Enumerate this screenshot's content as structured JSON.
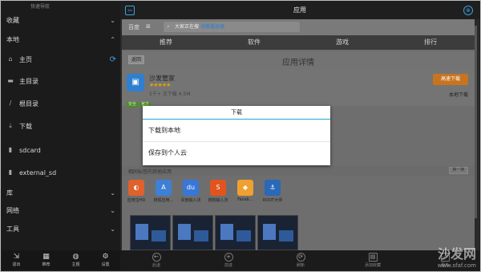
{
  "sidebar": {
    "top_hint": "快速导航",
    "items": [
      {
        "label": "收藏",
        "type": "section",
        "chev": "⌄"
      },
      {
        "label": "本地",
        "type": "section",
        "chev": "⌃"
      },
      {
        "label": "主页",
        "icon": "⌂",
        "refresh": "⟳"
      },
      {
        "label": "主目录",
        "icon": "▬"
      },
      {
        "label": "根目录",
        "icon": "/"
      },
      {
        "label": "下载",
        "icon": "⤓"
      },
      {
        "label": "sdcard",
        "icon": "▮"
      },
      {
        "label": "external_sd",
        "icon": "▮"
      },
      {
        "label": "库",
        "type": "section",
        "chev": "⌄"
      },
      {
        "label": "网络",
        "type": "section",
        "chev": "⌄"
      },
      {
        "label": "工具",
        "type": "section",
        "chev": "⌄"
      }
    ],
    "toolbar": [
      {
        "label": "退出",
        "icon": "⇲"
      },
      {
        "label": "推荐",
        "icon": "▦"
      },
      {
        "label": "主题",
        "icon": "◍"
      },
      {
        "label": "设置",
        "icon": "⚙"
      }
    ]
  },
  "main": {
    "title": "应用",
    "back_icon": "⇦",
    "close_icon": "⊗",
    "store": {
      "brand": "百度",
      "win_icon": "⊞",
      "search_prefix": "大家正在搜",
      "search_highlight": "海螺播放器",
      "tabs": [
        "推荐",
        "软件",
        "游戏",
        "排行"
      ],
      "return_label": "返回",
      "detail_title": "应用详情",
      "app_name": "沙发管家",
      "app_icon": "▣",
      "stars": "★★★★★",
      "meta": "5千+ 次下载 4.5M",
      "download_button": "高速下载",
      "download_sub": "本地下载",
      "badges": [
        "安全",
        "官方"
      ],
      "rec_title": "相同标签的其他应用",
      "more_label": "换一换",
      "rec_apps": [
        {
          "label": "应用宝HD",
          "icon": "◐",
          "color": "#e0612c"
        },
        {
          "label": "搜狐应用…",
          "icon": "A",
          "color": "#3f7fd6"
        },
        {
          "label": "百度输入法",
          "icon": "du",
          "color": "#3777d8"
        },
        {
          "label": "搜狗输入法",
          "icon": "S",
          "color": "#e2541e"
        },
        {
          "label": "Faceb…",
          "icon": "◆",
          "color": "#f0a030"
        },
        {
          "label": "ROOT大师",
          "icon": "⚓",
          "color": "#2a68b8"
        }
      ]
    },
    "dialog": {
      "title": "下载",
      "options": [
        "下载到本地",
        "保存到个人云"
      ]
    },
    "toolbar": [
      {
        "label": "后退",
        "icon": "←"
      },
      {
        "label": "前进",
        "icon": "+"
      },
      {
        "label": "刷新",
        "icon": "⟳"
      },
      {
        "label": "添加收藏",
        "icon": "▤"
      },
      {
        "label": "更多",
        "icon": "⋯"
      }
    ]
  },
  "watermark": {
    "name": "沙发网",
    "url": "www.sfaf.com"
  },
  "colors": {
    "accent": "#3aa0e0",
    "dialog_divider": "#1da8d5",
    "download_button": "#c8741f"
  }
}
